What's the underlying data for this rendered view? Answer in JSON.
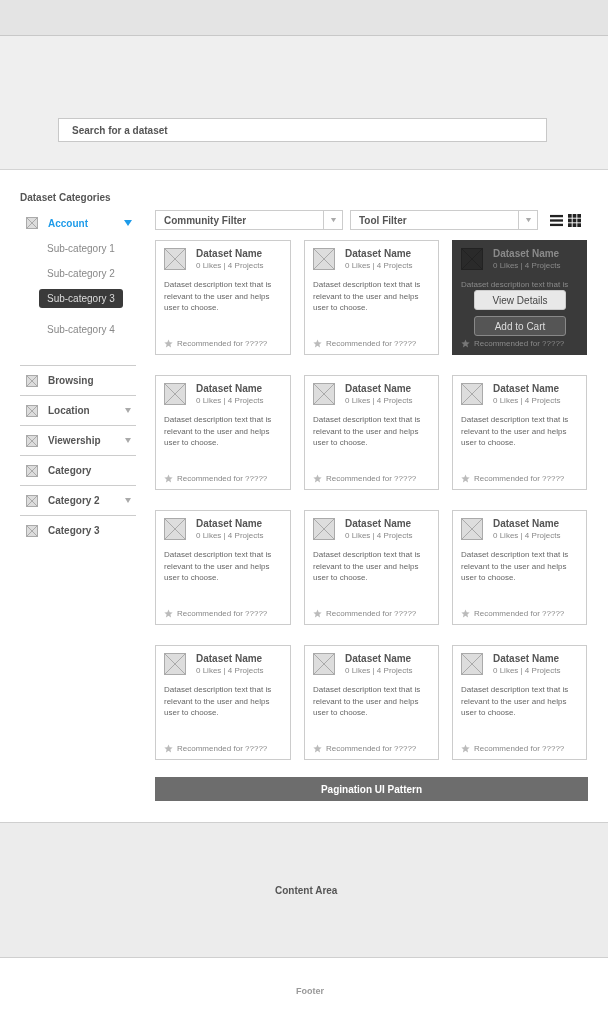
{
  "search": {
    "placeholder": "Search for a dataset"
  },
  "sidebar": {
    "title": "Dataset Categories",
    "items": [
      {
        "label": "Account",
        "selected": true,
        "expanded": true,
        "children": [
          {
            "label": "Sub-category 1",
            "selected": false
          },
          {
            "label": "Sub-category 2",
            "selected": false
          },
          {
            "label": "Sub-category 3",
            "selected": true
          },
          {
            "label": "Sub-category 4",
            "selected": false
          }
        ]
      },
      {
        "label": "Browsing",
        "selected": false
      },
      {
        "label": "Location",
        "selected": false,
        "expanded": false
      },
      {
        "label": "Viewership",
        "selected": false,
        "expanded": false
      },
      {
        "label": "Category",
        "selected": false
      },
      {
        "label": "Category  2",
        "selected": false,
        "expanded": false
      },
      {
        "label": "Category  3",
        "selected": false
      }
    ]
  },
  "filters": [
    {
      "label": "Community Filter"
    },
    {
      "label": "Tool Filter"
    }
  ],
  "cards": [
    {
      "name": "Dataset Name",
      "meta": "0 Likes | 4 Projects",
      "description": "Dataset description text that is relevant to the user and helps user to choose.",
      "recommendation": "Recommended for ?????",
      "hovered": false
    },
    {
      "name": "Dataset Name",
      "meta": "0 Likes | 4 Projects",
      "description": "Dataset description text that is relevant to the user and helps user to choose.",
      "recommendation": "Recommended for ?????",
      "hovered": false
    },
    {
      "name": "Dataset Name",
      "meta": "0 Likes | 4 Projects",
      "description": "Dataset description text that is",
      "recommendation": "Recommended for ?????",
      "hovered": true,
      "actions": [
        "View Details",
        "Add to Cart"
      ]
    },
    {
      "name": "Dataset Name",
      "meta": "0 Likes | 4 Projects",
      "description": "Dataset description text that is relevant to the user and helps user to choose.",
      "recommendation": "Recommended for ?????",
      "hovered": false
    },
    {
      "name": "Dataset Name",
      "meta": "0 Likes | 4 Projects",
      "description": "Dataset description text that is relevant to the user and helps user to choose.",
      "recommendation": "Recommended for ?????",
      "hovered": false
    },
    {
      "name": "Dataset Name",
      "meta": "0 Likes | 4 Projects",
      "description": "Dataset description text that is relevant to the user and helps user to choose.",
      "recommendation": "Recommended for ?????",
      "hovered": false
    },
    {
      "name": "Dataset Name",
      "meta": "0 Likes | 4 Projects",
      "description": "Dataset description text that is relevant to the user and helps user to choose.",
      "recommendation": "Recommended for ?????",
      "hovered": false
    },
    {
      "name": "Dataset Name",
      "meta": "0 Likes | 4 Projects",
      "description": "Dataset description text that is relevant to the user and helps user to choose.",
      "recommendation": "Recommended for ?????",
      "hovered": false
    },
    {
      "name": "Dataset Name",
      "meta": "0 Likes | 4 Projects",
      "description": "Dataset description text that is relevant to the user and helps user to choose.",
      "recommendation": "Recommended for ?????",
      "hovered": false
    },
    {
      "name": "Dataset Name",
      "meta": "0 Likes | 4 Projects",
      "description": "Dataset description text that is relevant to the user and helps user to choose.",
      "recommendation": "Recommended for ?????",
      "hovered": false
    },
    {
      "name": "Dataset Name",
      "meta": "0 Likes | 4 Projects",
      "description": "Dataset description text that is relevant to the user and helps user to choose.",
      "recommendation": "Recommended for ?????",
      "hovered": false
    },
    {
      "name": "Dataset Name",
      "meta": "0 Likes | 4 Projects",
      "description": "Dataset description text that is relevant to the user and helps user to choose.",
      "recommendation": "Recommended for ?????",
      "hovered": false
    }
  ],
  "pagination": {
    "label": "Pagination UI Pattern"
  },
  "content_area": {
    "label": "Content Area"
  },
  "footer": {
    "label": "Footer"
  }
}
